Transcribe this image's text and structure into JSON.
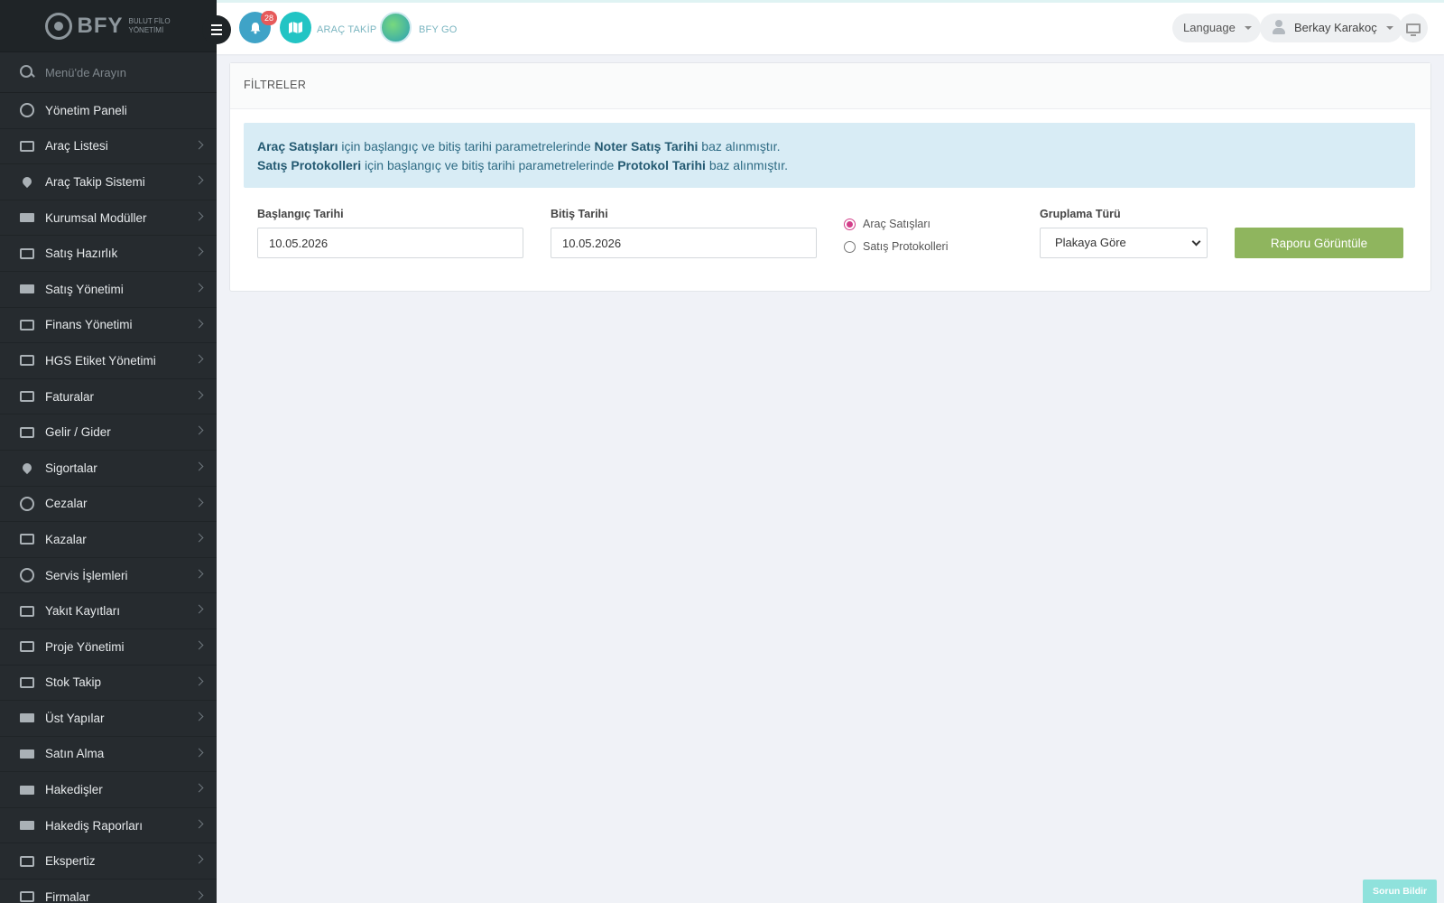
{
  "brand": {
    "name": "BFY",
    "subtitle": "BULUT FİLO YÖNETİMİ"
  },
  "sidebar": {
    "search_placeholder": "Menü'de Arayın",
    "items": [
      {
        "label": "Yönetim Paneli",
        "icon": "dashboard-icon"
      },
      {
        "label": "Araç Listesi",
        "icon": "bus-icon"
      },
      {
        "label": "Araç Takip Sistemi",
        "icon": "map-pin-icon"
      },
      {
        "label": "Kurumsal Modüller",
        "icon": "server-icon"
      },
      {
        "label": "Satış Hazırlık",
        "icon": "book-icon"
      },
      {
        "label": "Satış Yönetimi",
        "icon": "credit-card-icon"
      },
      {
        "label": "Finans Yönetimi",
        "icon": "money-icon"
      },
      {
        "label": "HGS Etiket Yönetimi",
        "icon": "tag-icon"
      },
      {
        "label": "Faturalar",
        "icon": "file-icon"
      },
      {
        "label": "Gelir / Gider",
        "icon": "money-icon"
      },
      {
        "label": "Sigortalar",
        "icon": "umbrella-icon"
      },
      {
        "label": "Cezalar",
        "icon": "times-circle-icon"
      },
      {
        "label": "Kazalar",
        "icon": "car-crash-icon"
      },
      {
        "label": "Servis İşlemleri",
        "icon": "check-circle-icon"
      },
      {
        "label": "Yakıt Kayıtları",
        "icon": "fuel-pump-icon"
      },
      {
        "label": "Proje Yönetimi",
        "icon": "briefcase-icon"
      },
      {
        "label": "Stok Takip",
        "icon": "inbox-icon"
      },
      {
        "label": "Üst Yapılar",
        "icon": "truck-icon"
      },
      {
        "label": "Satın Alma",
        "icon": "credit-card-icon"
      },
      {
        "label": "Hakedişler",
        "icon": "truck-icon"
      },
      {
        "label": "Hakediş Raporları",
        "icon": "truck-icon"
      },
      {
        "label": "Ekspertiz",
        "icon": "list-alt-icon"
      },
      {
        "label": "Firmalar",
        "icon": "building-icon"
      }
    ]
  },
  "topbar": {
    "notification_count": "28",
    "arac_takip_label": "ARAÇ TAKİP",
    "bfy_go_label": "BFY GO",
    "language_label": "Language",
    "user_name": "Berkay Karakoç"
  },
  "filters": {
    "title": "FİLTRELER",
    "info": {
      "line1": {
        "bold1": "Araç Satışları",
        "text1": " için başlangıç ve bitiş tarihi parametrelerinde ",
        "bold2": "Noter Satış Tarihi",
        "text2": " baz alınmıştır."
      },
      "line2": {
        "bold1": "Satış Protokolleri",
        "text1": " için başlangıç ve bitiş tarihi parametrelerinde ",
        "bold2": "Protokol Tarihi",
        "text2": " baz alınmıştır."
      }
    },
    "start_date_label": "Başlangıç Tarihi",
    "start_date_value": "10.05.2026",
    "end_date_label": "Bitiş Tarihi",
    "end_date_value": "10.05.2026",
    "radio_options": [
      {
        "label": "Araç Satışları",
        "selected": true
      },
      {
        "label": "Satış Protokolleri",
        "selected": false
      }
    ],
    "grouping_label": "Gruplama Türü",
    "grouping_value": "Plakaya Göre",
    "submit_label": "Raporu Görüntüle"
  },
  "report_issue_label": "Sorun Bildir",
  "colors": {
    "sidebar": "#262b2f",
    "accent_green": "#8fb55e",
    "info_bg": "#d8ecf5",
    "radio_active": "#d23d89",
    "badge": "#e65a5a"
  }
}
